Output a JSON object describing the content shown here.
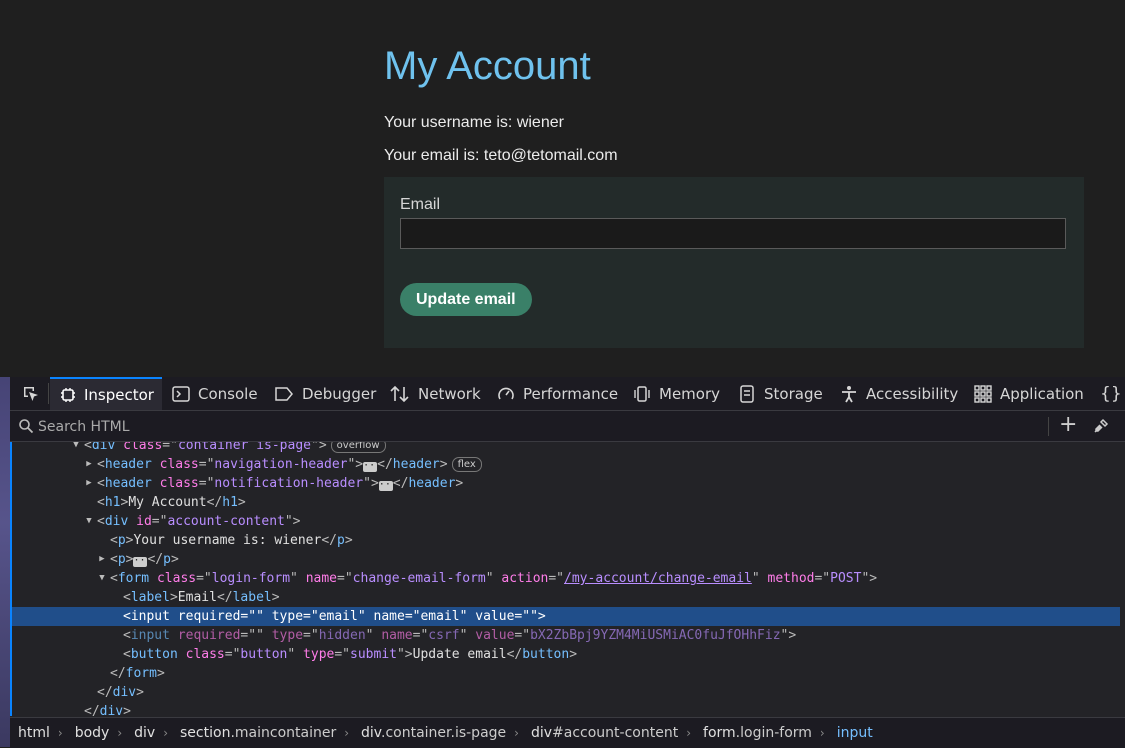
{
  "page": {
    "title": "My Account",
    "username_line": "Your username is: wiener",
    "email_line": "Your email is: teto@tetomail.com",
    "form": {
      "email_label": "Email",
      "email_value": "",
      "button_label": "Update email"
    }
  },
  "devtools": {
    "tabs": [
      "Inspector",
      "Console",
      "Debugger",
      "Network",
      "Performance",
      "Memory",
      "Storage",
      "Accessibility",
      "Application"
    ],
    "search_placeholder": "Search HTML",
    "markup": {
      "r0": {
        "tag": "div",
        "attr": "class",
        "val": "container is-page",
        "badge": "overflow"
      },
      "r1": {
        "tag": "header",
        "attr": "class",
        "val": "navigation-header",
        "badge": "flex"
      },
      "r2": {
        "tag": "header",
        "attr": "class",
        "val": "notification-header"
      },
      "r3": {
        "tag": "h1",
        "text": "My Account"
      },
      "r4": {
        "tag": "div",
        "attr": "id",
        "val": "account-content"
      },
      "r5": {
        "tag": "p",
        "text": "Your username is: wiener"
      },
      "r6": {
        "tag": "p"
      },
      "r7": {
        "tag": "form",
        "a1": "class",
        "v1": "login-form",
        "a2": "name",
        "v2": "change-email-form",
        "a3": "action",
        "v3": "/my-account/change-email",
        "a4": "method",
        "v4": "POST"
      },
      "r8": {
        "tag": "label",
        "text": "Email"
      },
      "r9": {
        "tag": "input",
        "a1": "required",
        "v1": "",
        "a2": "type",
        "v2": "email",
        "a3": "name",
        "v3": "email",
        "a4": "value",
        "v4": ""
      },
      "r10": {
        "tag": "input",
        "a1": "required",
        "v1": "",
        "a2": "type",
        "v2": "hidden",
        "a3": "name",
        "v3": "csrf",
        "a4": "value",
        "v4": "bX2ZbBpj9YZM4MiUSMiAC0fuJfOHhFiz"
      },
      "r11": {
        "tag": "button",
        "a1": "class",
        "v1": "button",
        "a2": "type",
        "v2": "submit",
        "text": "Update email"
      },
      "r12": {
        "tag": "form"
      },
      "r13": {
        "tag": "div"
      },
      "r14": {
        "tag": "div"
      }
    },
    "breadcrumb": [
      {
        "tag": "html",
        "cls": ""
      },
      {
        "tag": "body",
        "cls": ""
      },
      {
        "tag": "div",
        "cls": ""
      },
      {
        "tag": "section",
        "cls": ".maincontainer"
      },
      {
        "tag": "div",
        "cls": ".container.is-page"
      },
      {
        "tag": "div",
        "cls": "#account-content"
      },
      {
        "tag": "form",
        "cls": ".login-form"
      },
      {
        "tag": "input",
        "cls": ""
      }
    ]
  },
  "colors": {
    "accent": "#0a84ff",
    "title": "#6fc2ee",
    "button": "#3a8068"
  }
}
